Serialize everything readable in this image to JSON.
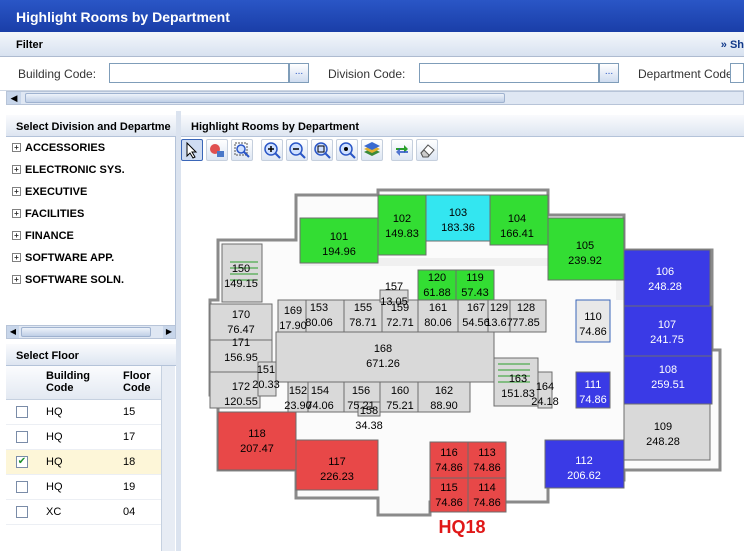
{
  "title": "Highlight Rooms by Department",
  "filter": {
    "label": "Filter",
    "more": "» Sh",
    "building_label": "Building Code:",
    "division_label": "Division Code:",
    "department_label": "Department Code:",
    "browse_glyph": "..."
  },
  "left_panel": {
    "title": "Select Division and Departme",
    "divisions": [
      "ACCESSORIES",
      "ELECTRONIC SYS.",
      "EXECUTIVE",
      "FACILITIES",
      "FINANCE",
      "SOFTWARE APP.",
      "SOFTWARE SOLN."
    ]
  },
  "floor_panel": {
    "title": "Select Floor",
    "col_building": "Building Code",
    "col_floor": "Floor Code",
    "rows": [
      {
        "building": "HQ",
        "floor": "15",
        "checked": false
      },
      {
        "building": "HQ",
        "floor": "17",
        "checked": false
      },
      {
        "building": "HQ",
        "floor": "18",
        "checked": true
      },
      {
        "building": "HQ",
        "floor": "19",
        "checked": false
      },
      {
        "building": "XC",
        "floor": "04",
        "checked": false
      }
    ]
  },
  "map_panel": {
    "title": "Highlight Rooms by Department",
    "floor_label": "HQ18",
    "tools": [
      "select-icon",
      "pan-icon",
      "zoom-window-icon",
      "zoom-in-icon",
      "zoom-out-icon",
      "zoom-extents-icon",
      "zoom-fit-icon",
      "layers-icon",
      "refresh-icon",
      "eraser-icon"
    ]
  },
  "rooms": [
    {
      "id": "101",
      "area": "194.96",
      "color": "#33dd33"
    },
    {
      "id": "102",
      "area": "149.83",
      "color": "#33dd33"
    },
    {
      "id": "103",
      "area": "183.36",
      "color": "#33e6f0"
    },
    {
      "id": "104",
      "area": "166.41",
      "color": "#33dd33"
    },
    {
      "id": "105",
      "area": "239.92",
      "color": "#33dd33"
    },
    {
      "id": "106",
      "area": "248.28",
      "color": "#3a3ae6"
    },
    {
      "id": "107",
      "area": "241.75",
      "color": "#3a3ae6"
    },
    {
      "id": "108",
      "area": "259.51",
      "color": "#3a3ae6"
    },
    {
      "id": "109",
      "area": "248.28",
      "color": "#d9d9d9"
    },
    {
      "id": "110",
      "area": "74.86",
      "color": "#e8e8e8"
    },
    {
      "id": "111",
      "area": "74.86",
      "color": "#3a3ae6"
    },
    {
      "id": "112",
      "area": "206.62",
      "color": "#3a3ae6"
    },
    {
      "id": "113",
      "area": "74.86",
      "color": "#e84848"
    },
    {
      "id": "114",
      "area": "74.86",
      "color": "#e84848"
    },
    {
      "id": "115",
      "area": "74.86",
      "color": "#e84848"
    },
    {
      "id": "116",
      "area": "74.86",
      "color": "#e84848"
    },
    {
      "id": "117",
      "area": "226.23",
      "color": "#e84848"
    },
    {
      "id": "118",
      "area": "207.47",
      "color": "#e84848"
    },
    {
      "id": "119",
      "area": "57.43",
      "color": "#33dd33"
    },
    {
      "id": "120",
      "area": "61.88",
      "color": "#33dd33"
    },
    {
      "id": "150",
      "area": "149.15",
      "color": "#d9d9d9"
    },
    {
      "id": "153",
      "area": "80.06",
      "color": "#d9d9d9"
    },
    {
      "id": "155",
      "area": "78.71",
      "color": "#d9d9d9"
    },
    {
      "id": "159",
      "area": "72.71",
      "color": "#d9d9d9"
    },
    {
      "id": "161",
      "area": "80.06",
      "color": "#d9d9d9"
    },
    {
      "id": "167",
      "area": "54.56",
      "color": "#d9d9d9"
    },
    {
      "id": "129",
      "area": "13.67",
      "color": "#d9d9d9"
    },
    {
      "id": "128",
      "area": "77.85",
      "color": "#d9d9d9"
    },
    {
      "id": "157",
      "area": "13.05",
      "color": "#d9d9d9"
    },
    {
      "id": "169",
      "area": "17.90",
      "color": "#d9d9d9"
    },
    {
      "id": "170",
      "area": "76.47",
      "color": "#d9d9d9"
    },
    {
      "id": "171",
      "area": "156.95",
      "color": "#d9d9d9"
    },
    {
      "id": "172",
      "area": "120.55",
      "color": "#d9d9d9"
    },
    {
      "id": "151",
      "area": "20.33",
      "color": "#d9d9d9"
    },
    {
      "id": "168",
      "area": "671.26",
      "color": "#d9d9d9"
    },
    {
      "id": "152",
      "area": "23.90",
      "color": "#d9d9d9"
    },
    {
      "id": "154",
      "area": "74.06",
      "color": "#d9d9d9"
    },
    {
      "id": "156",
      "area": "75.21",
      "color": "#d9d9d9"
    },
    {
      "id": "158",
      "area": "34.38",
      "color": "#d9d9d9"
    },
    {
      "id": "160",
      "area": "75.21",
      "color": "#d9d9d9"
    },
    {
      "id": "162",
      "area": "88.90",
      "color": "#d9d9d9"
    },
    {
      "id": "163",
      "area": "151.83",
      "color": "#d9d9d9"
    },
    {
      "id": "164",
      "area": "24.18",
      "color": "#d9d9d9"
    }
  ]
}
